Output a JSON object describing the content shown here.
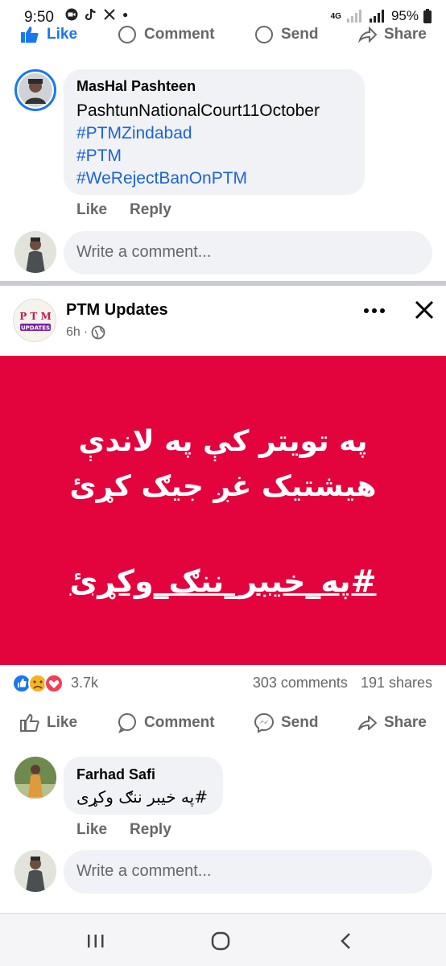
{
  "status_bar": {
    "time": "9:50",
    "battery": "95%",
    "network": "4G"
  },
  "actions_top": {
    "like": "Like",
    "comment": "Comment",
    "send": "Send",
    "share": "Share"
  },
  "comment1": {
    "author": "MasHal Pashteen",
    "lines": [
      "PashtunNationalCourt11October",
      "#PTMZindabad",
      "#PTM",
      "#WeRejectBanOnPTM"
    ],
    "like": "Like",
    "reply": "Reply"
  },
  "write_comment": {
    "placeholder": "Write a comment..."
  },
  "post": {
    "page_name": "PTM Updates",
    "time": "6h",
    "logo_text_top": "P T M",
    "logo_text_bottom": "UPDATES",
    "image_line1": "په تویتر کې په لاندې",
    "image_line2": "هیشتیک غږ جیګ کړئ",
    "image_hashtag": "#په_خیبر_ننګ_وکړئ",
    "reaction_count": "3.7k",
    "comments": "303 comments",
    "shares": "191 shares"
  },
  "actions_post": {
    "like": "Like",
    "comment": "Comment",
    "send": "Send",
    "share": "Share"
  },
  "comment2": {
    "author": "Farhad Safi",
    "text": "#په خیبر ننګ وکړی",
    "like": "Like",
    "reply": "Reply"
  },
  "colors": {
    "accent": "#1877f2",
    "post_bg": "#e3033d",
    "hashtag": "#1b64d8"
  }
}
